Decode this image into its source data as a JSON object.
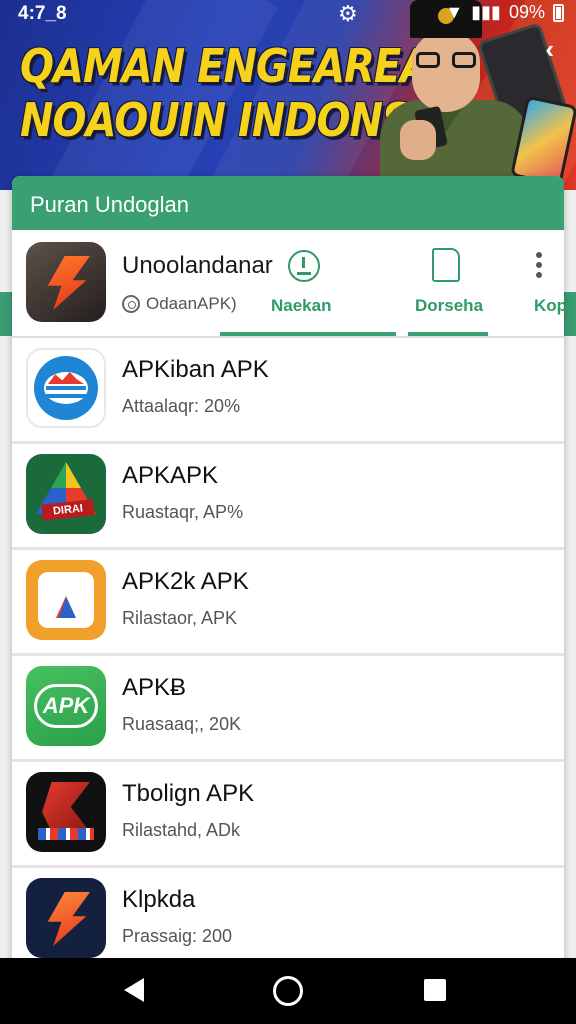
{
  "status_bar": {
    "time": "4:7_8",
    "battery_text": "09%"
  },
  "banner": {
    "headline_line1": "QAMAN ENGEAREAN",
    "headline_line2": "NOAOUIN INDONSII"
  },
  "card": {
    "header_title": "Puran Undoglan",
    "top_app": {
      "name": "Unoolandanar",
      "status": "OdaanAPK)",
      "icon": "bolt-app-icon"
    },
    "tabs": [
      {
        "label": "Naekan"
      },
      {
        "label": "Dorseha"
      },
      {
        "label": "Kop"
      }
    ]
  },
  "apps": [
    {
      "name": "APKiban APK",
      "sub": "Attaalaqr: 20%",
      "icon": "blue-wave-icon"
    },
    {
      "name": "APKAPK",
      "sub": "Ruastaqr, AP%",
      "icon": "multicolor-a-icon"
    },
    {
      "name": "APK2k APK",
      "sub": "Rilastaor, APK",
      "icon": "orange-triangle-icon"
    },
    {
      "name": "APKɃ",
      "sub": "Ruasaaq;, 20K",
      "icon": "apk-badge-icon"
    },
    {
      "name": "Tbolign APK",
      "sub": "Rilastahd, ADk",
      "icon": "dark-x-icon"
    },
    {
      "name": "Klpkda",
      "sub": "Prassaig: 200",
      "icon": "navy-bolt-icon"
    }
  ],
  "colors": {
    "accent": "#3aa074",
    "tab_text": "#2f9a68"
  }
}
